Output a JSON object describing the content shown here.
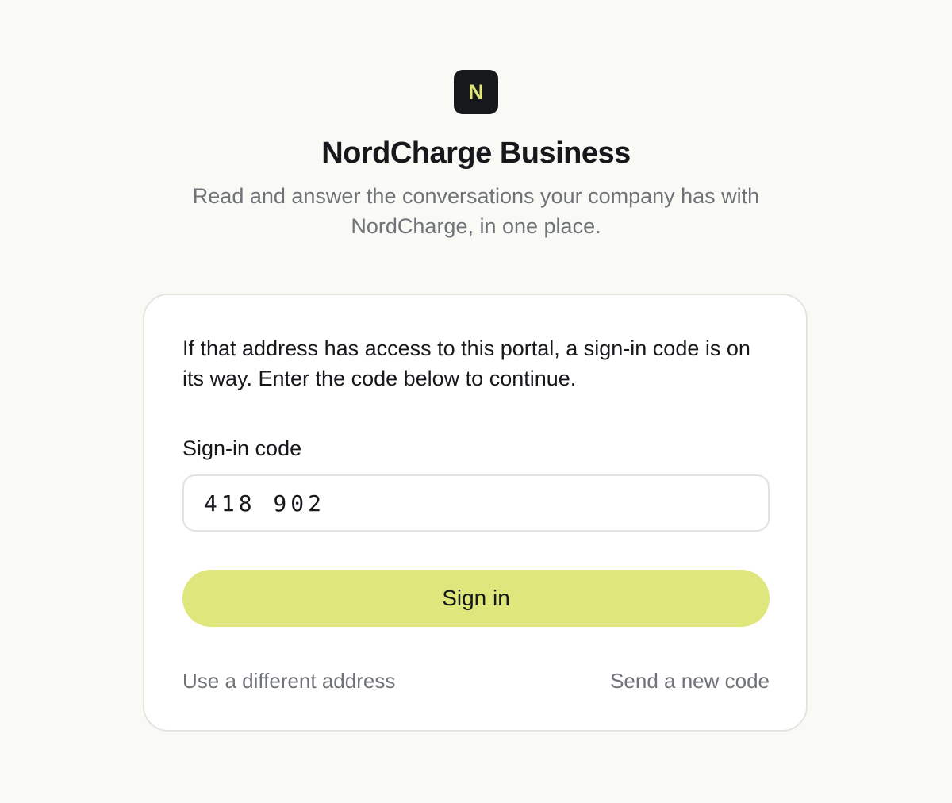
{
  "brand": {
    "logo_letter": "N",
    "title": "NordCharge Business",
    "subtitle": "Read and answer the conversations your company has with NordCharge, in one place."
  },
  "card": {
    "message": "If that address has access to this portal, a sign-in code is on its way. Enter the code below to continue.",
    "code_field": {
      "label": "Sign-in code",
      "value": "418 902"
    },
    "sign_in_label": "Sign in",
    "links": {
      "different_address": "Use a different address",
      "new_code": "Send a new code"
    }
  },
  "colors": {
    "background": "#f9f9f6",
    "accent": "#dfe67c",
    "logo_background": "#16181b",
    "muted_text": "#6f7378"
  }
}
